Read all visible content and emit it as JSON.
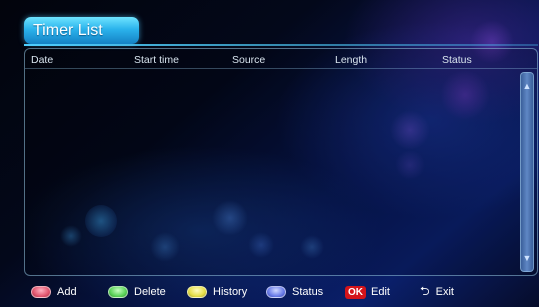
{
  "window": {
    "title": "Timer List"
  },
  "table": {
    "columns": [
      "Date",
      "Start time",
      "Source",
      "Length",
      "Status"
    ],
    "rows": []
  },
  "footer": {
    "add": {
      "label": "Add",
      "color": "#e2566f",
      "icon": "red-key-icon"
    },
    "delete": {
      "label": "Delete",
      "color": "#5cd45a",
      "icon": "green-key-icon"
    },
    "history": {
      "label": "History",
      "color": "#e6e04a",
      "icon": "yellow-key-icon"
    },
    "status": {
      "label": "Status",
      "color": "#6b7de8",
      "icon": "blue-key-icon"
    },
    "edit": {
      "key": "OK",
      "label": "Edit",
      "icon": "ok-key-icon"
    },
    "exit": {
      "label": "Exit",
      "icon": "return-arrow-icon"
    }
  },
  "colors": {
    "accent": "#2bb3ec",
    "ok_red": "#d4141a"
  }
}
